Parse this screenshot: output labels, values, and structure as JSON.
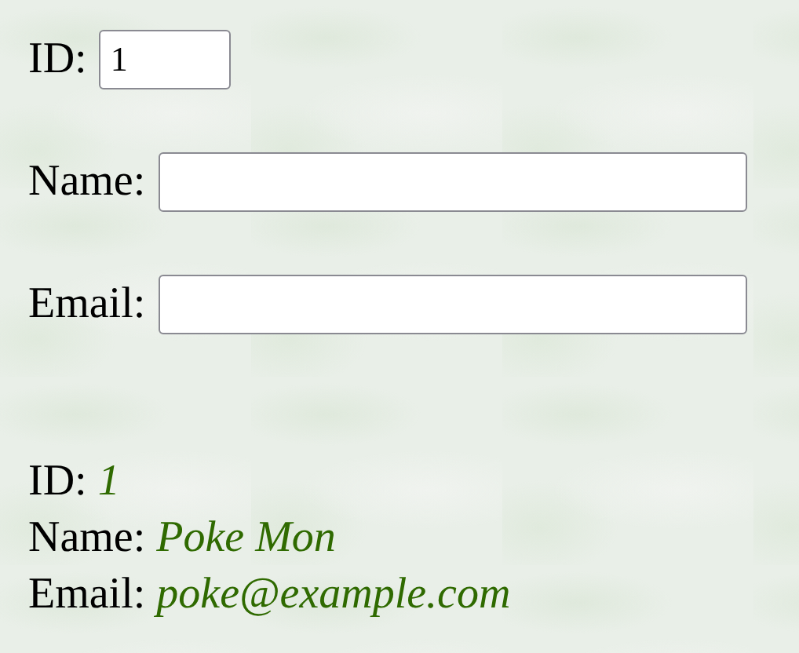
{
  "form": {
    "fields": [
      {
        "kind": "short",
        "label": "ID:",
        "value": "1"
      },
      {
        "kind": "wide",
        "label": "Name:"
      },
      {
        "kind": "wide",
        "label": "Email:"
      }
    ]
  },
  "output": [
    {
      "label": "ID:",
      "value": "1"
    },
    {
      "label": "Name:",
      "value": "Poke Mon"
    },
    {
      "label": "Email:",
      "value": "poke@example.com"
    }
  ]
}
